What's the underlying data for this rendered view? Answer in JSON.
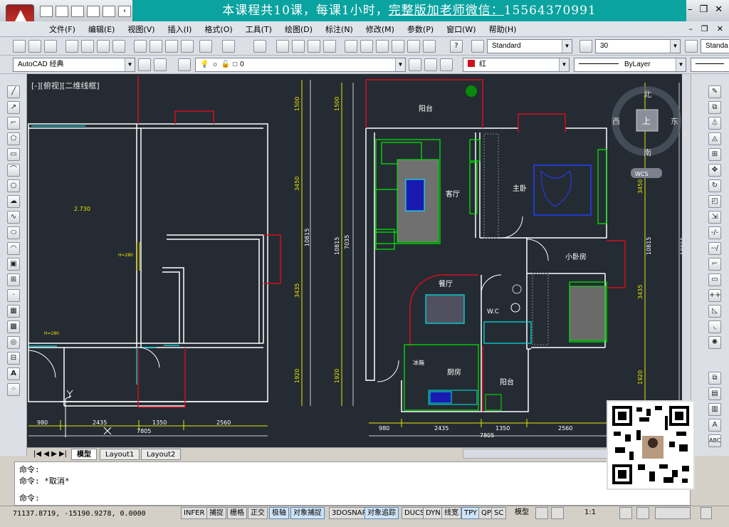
{
  "banner": {
    "prefix": "本课程共10课，每课1小时，",
    "link": "完整版加老师微信：",
    "phone": "15564370991"
  },
  "menu": [
    "文件(F)",
    "编辑(E)",
    "视图(V)",
    "插入(I)",
    "格式(O)",
    "工具(T)",
    "绘图(D)",
    "标注(N)",
    "修改(M)",
    "参数(P)",
    "窗口(W)",
    "帮助(H)"
  ],
  "toolbar": {
    "text_style": "Standard",
    "dim_scale": "30",
    "dim_style": "Standa",
    "workspace": "AutoCAD 经典",
    "layer": "0",
    "color": "红",
    "linetype": "ByLayer"
  },
  "viewport_label": "[-][俯视][二维线框]",
  "compass": {
    "north": "北",
    "south": "南",
    "east": "东",
    "west": "西",
    "center": "上",
    "wcs": "WCS"
  },
  "drawing": {
    "rooms": [
      "阳台",
      "客厅",
      "主卧",
      "小卧房",
      "餐厅",
      "W.C",
      "厨房",
      "阳台",
      "冰箱"
    ],
    "left_dims_bottom": [
      "980",
      "2435",
      "1350",
      "2560"
    ],
    "left_total": "7805",
    "right_dims_bottom": [
      "980",
      "2435",
      "1350",
      "2560"
    ],
    "right_total": "7805",
    "vertical_dims": [
      "1500",
      "3450",
      "3435",
      "1920"
    ],
    "vertical_total": "10815",
    "vertical_mid": "7035",
    "notes": [
      "2.730",
      "H=280",
      "H=280"
    ]
  },
  "tabs": [
    "模型",
    "Layout1",
    "Layout2"
  ],
  "command": {
    "line1": "命令:",
    "line2": "命令: *取消*",
    "prompt": "命令:"
  },
  "status": {
    "coords": "71137.8719, -15190.9278, 0.0000",
    "toggles": [
      "INFER",
      "捕捉",
      "栅格",
      "正交",
      "极轴",
      "对象捕捉",
      "3DOSNAP",
      "对象追踪",
      "DUCS",
      "DYN",
      "线宽",
      "TPY",
      "QP",
      "SC"
    ],
    "model": "模型",
    "scale": "1:1"
  },
  "colors": {
    "banner": "#0aa3a0",
    "canvas": "#252b33",
    "wall": "#ffffff",
    "red": "#d0101e",
    "yellow": "#ffff00",
    "green": "#00ff00",
    "cyan": "#00ffff",
    "blue": "#0000ff"
  }
}
